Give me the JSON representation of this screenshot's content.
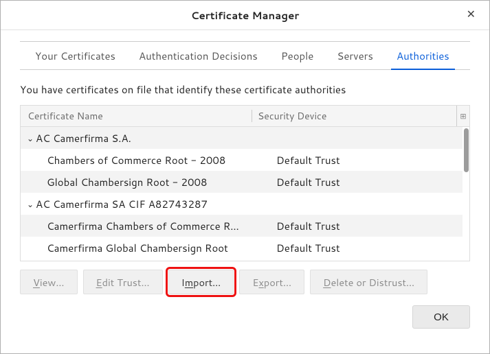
{
  "window": {
    "title": "Certificate Manager"
  },
  "tabs": [
    {
      "label": "Your Certificates",
      "active": false
    },
    {
      "label": "Authentication Decisions",
      "active": false
    },
    {
      "label": "People",
      "active": false
    },
    {
      "label": "Servers",
      "active": false
    },
    {
      "label": "Authorities",
      "active": true
    }
  ],
  "intro": "You have certificates on file that identify these certificate authorities",
  "columns": {
    "name": "Certificate Name",
    "device": "Security Device"
  },
  "rows": [
    {
      "type": "group",
      "name": "AC Camerfirma S.A.",
      "device": "",
      "expanded": true
    },
    {
      "type": "child",
      "name": "Chambers of Commerce Root - 2008",
      "device": "Default Trust"
    },
    {
      "type": "child",
      "name": "Global Chambersign Root - 2008",
      "device": "Default Trust"
    },
    {
      "type": "group",
      "name": "AC Camerfirma SA CIF A82743287",
      "device": "",
      "expanded": true
    },
    {
      "type": "child",
      "name": "Camerfirma Chambers of Commerce R…",
      "device": "Default Trust"
    },
    {
      "type": "child",
      "name": "Camerfirma Global Chambersign Root",
      "device": "Default Trust"
    }
  ],
  "buttons": {
    "view": {
      "pre": "",
      "u": "V",
      "post": "iew…"
    },
    "edit": {
      "pre": "",
      "u": "E",
      "post": "dit Trust…"
    },
    "import": {
      "pre": "I",
      "u": "m",
      "post": "port…"
    },
    "export": {
      "pre": "E",
      "u": "x",
      "post": "port…"
    },
    "delete": {
      "pre": "",
      "u": "D",
      "post": "elete or Distrust…"
    }
  },
  "ok_label": "OK",
  "column_picker_glyph": "⊞"
}
